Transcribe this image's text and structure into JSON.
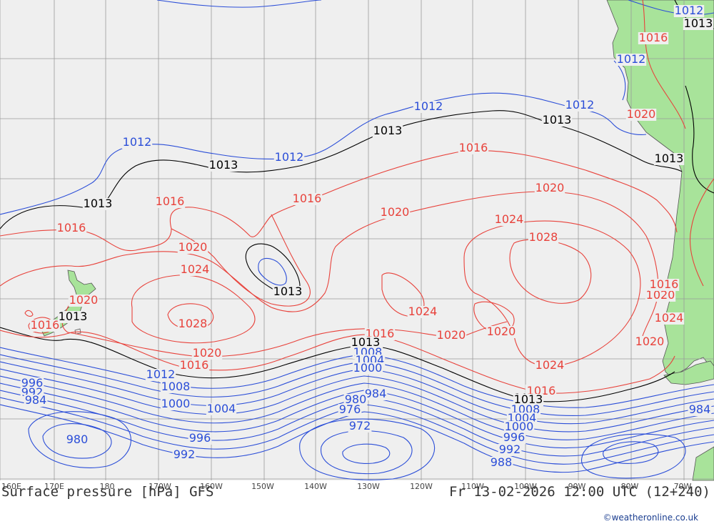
{
  "map": {
    "title": "Surface pressure [hPa] GFS",
    "valid_time": "Fr 13-02-2026 12:00 UTC (12+240)",
    "credit": "©weatheronline.co.uk",
    "longitude_labels": [
      "160E",
      "170E",
      "180",
      "170W",
      "160W",
      "150W",
      "140W",
      "130W",
      "120W",
      "110W",
      "100W",
      "90W",
      "80W",
      "70W"
    ],
    "colors": {
      "high": "#e8423b",
      "low": "#2b4ed8",
      "ref": "#000000",
      "ocean": "#efefef",
      "land": "#a8e39a",
      "grid": "#9a9a9a"
    },
    "labels": [
      {
        "text": "1012",
        "color": "blue"
      },
      {
        "text": "1013",
        "color": "black"
      },
      {
        "text": "1016",
        "color": "red"
      },
      {
        "text": "1012",
        "color": "blue"
      },
      {
        "text": "1013",
        "color": "black"
      },
      {
        "text": "1012",
        "color": "blue"
      },
      {
        "text": "1013",
        "color": "black"
      },
      {
        "text": "1012",
        "color": "blue"
      },
      {
        "text": "1013",
        "color": "black"
      },
      {
        "text": "1016",
        "color": "red"
      },
      {
        "text": "1012",
        "color": "blue"
      },
      {
        "text": "1013",
        "color": "black"
      },
      {
        "text": "1012",
        "color": "blue"
      },
      {
        "text": "1013",
        "color": "black"
      },
      {
        "text": "1016",
        "color": "red"
      },
      {
        "text": "1020",
        "color": "red"
      },
      {
        "text": "1013",
        "color": "black"
      },
      {
        "text": "1016",
        "color": "red"
      },
      {
        "text": "1016",
        "color": "red"
      },
      {
        "text": "1020",
        "color": "red"
      },
      {
        "text": "1020",
        "color": "red"
      },
      {
        "text": "1024",
        "color": "red"
      },
      {
        "text": "1028",
        "color": "red"
      },
      {
        "text": "1020",
        "color": "red"
      },
      {
        "text": "1016",
        "color": "red"
      },
      {
        "text": "1016",
        "color": "red"
      },
      {
        "text": "1020",
        "color": "red"
      },
      {
        "text": "1024",
        "color": "red"
      },
      {
        "text": "1028",
        "color": "red"
      },
      {
        "text": "1013",
        "color": "black"
      },
      {
        "text": "1024",
        "color": "red"
      },
      {
        "text": "1020",
        "color": "red"
      },
      {
        "text": "1020",
        "color": "red"
      },
      {
        "text": "1024",
        "color": "red"
      },
      {
        "text": "1016",
        "color": "red"
      },
      {
        "text": "1020",
        "color": "red"
      },
      {
        "text": "1024",
        "color": "red"
      },
      {
        "text": "1020",
        "color": "red"
      },
      {
        "text": "1013",
        "color": "black"
      },
      {
        "text": "1020",
        "color": "red"
      },
      {
        "text": "1016",
        "color": "red"
      },
      {
        "text": "1016",
        "color": "red"
      },
      {
        "text": "1013",
        "color": "black"
      },
      {
        "text": "1008",
        "color": "blue"
      },
      {
        "text": "1004",
        "color": "blue"
      },
      {
        "text": "1000",
        "color": "blue"
      },
      {
        "text": "1012",
        "color": "blue"
      },
      {
        "text": "1008",
        "color": "blue"
      },
      {
        "text": "1000",
        "color": "blue"
      },
      {
        "text": "1004",
        "color": "blue"
      },
      {
        "text": "996",
        "color": "blue"
      },
      {
        "text": "992",
        "color": "blue"
      },
      {
        "text": "984",
        "color": "blue"
      },
      {
        "text": "980",
        "color": "blue"
      },
      {
        "text": "996",
        "color": "blue"
      },
      {
        "text": "992",
        "color": "blue"
      },
      {
        "text": "984",
        "color": "blue"
      },
      {
        "text": "980",
        "color": "blue"
      },
      {
        "text": "976",
        "color": "blue"
      },
      {
        "text": "972",
        "color": "blue"
      },
      {
        "text": "1016",
        "color": "red"
      },
      {
        "text": "1013",
        "color": "black"
      },
      {
        "text": "1008",
        "color": "blue"
      },
      {
        "text": "1004",
        "color": "blue"
      },
      {
        "text": "1000",
        "color": "blue"
      },
      {
        "text": "996",
        "color": "blue"
      },
      {
        "text": "992",
        "color": "blue"
      },
      {
        "text": "988",
        "color": "blue"
      },
      {
        "text": "984",
        "color": "blue"
      }
    ]
  }
}
